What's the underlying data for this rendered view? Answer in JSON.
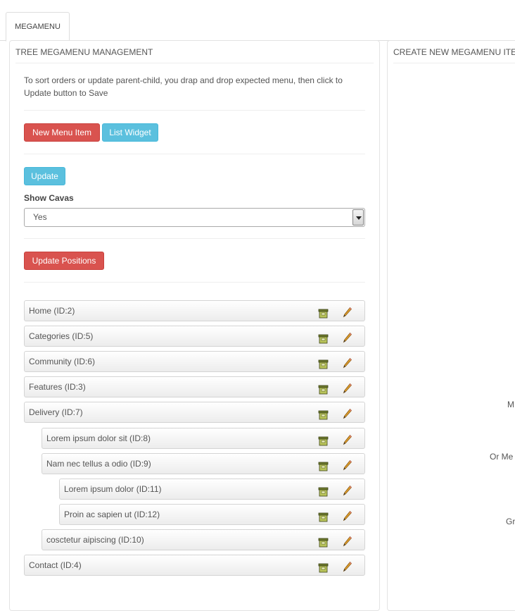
{
  "tabs": [
    {
      "label": "MEGAMENU"
    }
  ],
  "left_panel": {
    "title": "TREE MEGAMENU MANAGEMENT",
    "description": "To sort orders or update parent-child, you drap and drop expected menu, then click to Update button to Save",
    "new_menu_item_label": "New Menu Item",
    "list_widget_label": "List Widget",
    "update_label": "Update",
    "show_cavas_label": "Show Cavas",
    "show_cavas_value": "Yes",
    "update_positions_label": "Update Positions",
    "menu_items": [
      {
        "label": "Home (ID:2)",
        "level": 0
      },
      {
        "label": "Categories (ID:5)",
        "level": 0
      },
      {
        "label": "Community (ID:6)",
        "level": 0
      },
      {
        "label": "Features (ID:3)",
        "level": 0
      },
      {
        "label": "Delivery (ID:7)",
        "level": 0
      },
      {
        "label": "Lorem ipsum dolor sit (ID:8)",
        "level": 1
      },
      {
        "label": "Nam nec tellus a odio (ID:9)",
        "level": 1
      },
      {
        "label": "Lorem ipsum dolor (ID:11)",
        "level": 2
      },
      {
        "label": "Proin ac sapien ut (ID:12)",
        "level": 2
      },
      {
        "label": "cosctetur aipiscing (ID:10)",
        "level": 1
      },
      {
        "label": "Contact (ID:4)",
        "level": 0
      }
    ]
  },
  "right_panel": {
    "title": "CREATE NEW MEGAMENU ITEM.",
    "partial_texts": [
      "M",
      "Or Me",
      "Gr"
    ]
  },
  "colors": {
    "danger": "#d9534f",
    "info": "#5bc0de"
  },
  "icons": {
    "delete": "trash-box-icon",
    "edit": "pencil-icon"
  }
}
